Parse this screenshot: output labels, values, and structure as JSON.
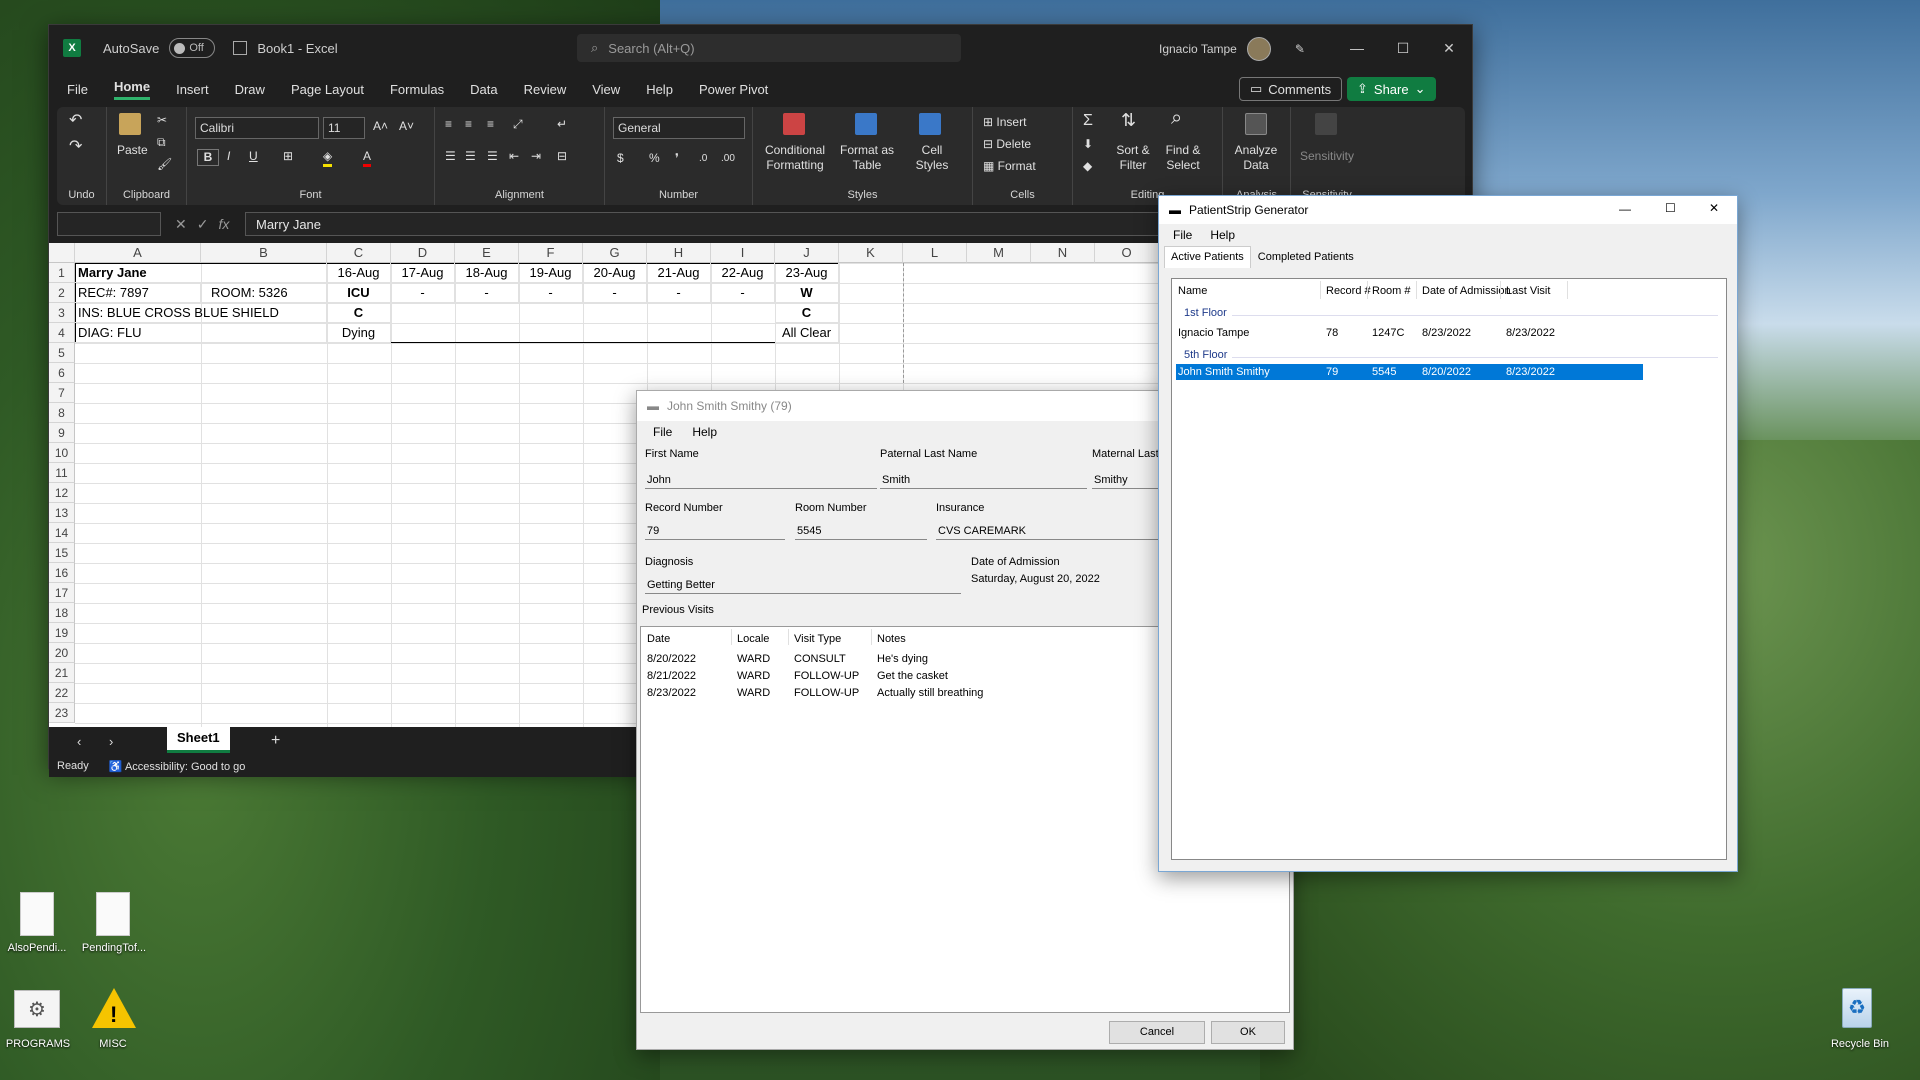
{
  "excel": {
    "app_letter": "X",
    "autosave_label": "AutoSave",
    "autosave_state": "Off",
    "doc_title": "Book1  -  Excel",
    "search_placeholder": "Search (Alt+Q)",
    "user_name": "Ignacio Tampe",
    "menu": [
      "File",
      "Home",
      "Insert",
      "Draw",
      "Page Layout",
      "Formulas",
      "Data",
      "Review",
      "View",
      "Help",
      "Power Pivot"
    ],
    "comments_label": "Comments",
    "share_label": "Share",
    "ribbon": {
      "undo_group": "Undo",
      "clipboard_group": "Clipboard",
      "paste_label": "Paste",
      "font_group": "Font",
      "font_name": "Calibri",
      "font_size": "11",
      "alignment_group": "Alignment",
      "number_group": "Number",
      "number_format": "General",
      "styles_group": "Styles",
      "conditional_formatting": "Conditional Formatting",
      "format_as_table": "Format as Table",
      "cell_styles": "Cell Styles",
      "cells_group": "Cells",
      "insert_label": "Insert",
      "delete_label": "Delete",
      "format_label": "Format",
      "editing_group": "Editing",
      "sort_filter": "Sort & Filter",
      "find_select": "Find & Select",
      "analysis_group": "Analysis",
      "analyze_data": "Analyze Data",
      "sensitivity_group": "Sensitivity",
      "sensitivity_label": "Sensitivity"
    },
    "formula_value": "Marry Jane",
    "columns": [
      "A",
      "B",
      "C",
      "D",
      "E",
      "F",
      "G",
      "H",
      "I",
      "J",
      "K",
      "L",
      "M",
      "N",
      "O"
    ],
    "rows": [
      "1",
      "2",
      "3",
      "4",
      "5",
      "6",
      "7",
      "8",
      "9",
      "10",
      "11",
      "12",
      "13",
      "14",
      "15",
      "16",
      "17",
      "18",
      "19",
      "20",
      "21",
      "22",
      "23"
    ],
    "cells": {
      "a1": "Marry Jane",
      "a2": "REC#: 7897",
      "b2": "ROOM: 5326",
      "a3": "INS: BLUE CROSS BLUE SHIELD",
      "a4": "DIAG: FLU",
      "dates": [
        "16-Aug",
        "17-Aug",
        "18-Aug",
        "19-Aug",
        "20-Aug",
        "21-Aug",
        "22-Aug",
        "23-Aug"
      ],
      "row2": [
        "ICU",
        "-",
        "-",
        "-",
        "-",
        "-",
        "-",
        "W"
      ],
      "row3": [
        "C",
        "",
        "",
        "",
        "",
        "",
        "",
        "C"
      ],
      "row4": [
        "Dying",
        "",
        "",
        "",
        "",
        "",
        "",
        "All Clear"
      ]
    },
    "sheet_tab": "Sheet1",
    "status_ready": "Ready",
    "status_accessibility": "Accessibility: Good to go"
  },
  "patient_dialog": {
    "title": "John Smith Smithy (79)",
    "menu": [
      "File",
      "Help"
    ],
    "first_name_label": "First Name",
    "first_name": "John",
    "paternal_label": "Paternal Last Name",
    "paternal": "Smith",
    "maternal_label": "Maternal Last",
    "maternal": "Smithy",
    "record_label": "Record Number",
    "record": "79",
    "room_label": "Room Number",
    "room": "5545",
    "insurance_label": "Insurance",
    "insurance": "CVS CAREMARK",
    "diagnosis_label": "Diagnosis",
    "diagnosis": "Getting Better",
    "admission_label": "Date of Admission",
    "admission": "Saturday, August 20, 2022",
    "visits_label": "Previous Visits",
    "visit_headers": [
      "Date",
      "Locale",
      "Visit Type",
      "Notes"
    ],
    "visits": [
      [
        "8/20/2022",
        "WARD",
        "CONSULT",
        "He's dying"
      ],
      [
        "8/21/2022",
        "WARD",
        "FOLLOW-UP",
        "Get the casket"
      ],
      [
        "8/23/2022",
        "WARD",
        "FOLLOW-UP",
        "Actually still breathing"
      ]
    ],
    "cancel_label": "Cancel",
    "ok_label": "OK"
  },
  "patient_strip": {
    "title": "PatientStrip Generator",
    "menu": [
      "File",
      "Help"
    ],
    "tabs": [
      "Active Patients",
      "Completed Patients"
    ],
    "headers": [
      "Name",
      "Record #",
      "Room #",
      "Date of Admission",
      "Last Visit"
    ],
    "groups": [
      {
        "name": "1st Floor",
        "rows": [
          [
            "Ignacio Tampe",
            "78",
            "1247C",
            "8/23/2022",
            "8/23/2022"
          ]
        ]
      },
      {
        "name": "5th Floor",
        "rows": [
          [
            "John Smith Smithy",
            "79",
            "5545",
            "8/20/2022",
            "8/23/2022"
          ]
        ]
      }
    ]
  },
  "desktop": {
    "icons": [
      "AlsoPendi...",
      "PendingTof...",
      "PROGRAMS",
      "MISC",
      "Recycle Bin"
    ]
  },
  "colors": {
    "excel_green": "#107c41",
    "selection_blue": "#0078d7",
    "warning_yellow": "#f5c400"
  }
}
